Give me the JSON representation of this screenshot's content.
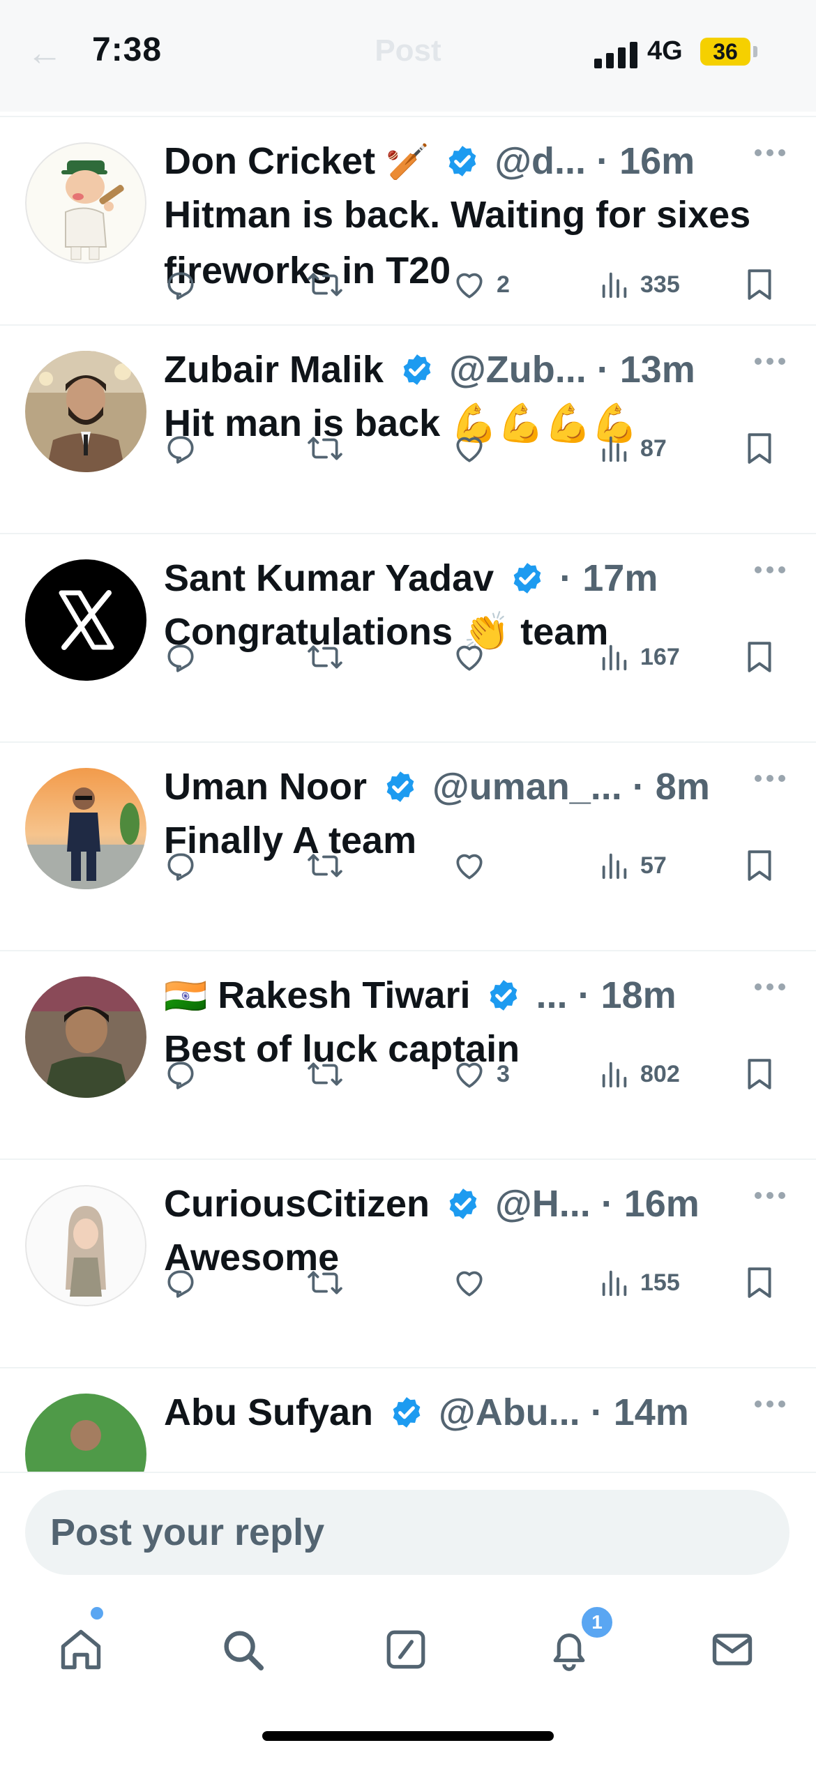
{
  "status_bar": {
    "time": "7:38",
    "network": "4G",
    "battery": "36"
  },
  "header": {
    "title": "Post"
  },
  "colors": {
    "accent": "#1d9bf0",
    "text": "#0f1419",
    "muted": "#536471",
    "battery": "#f5d000"
  },
  "tweets": [
    {
      "name": "Don Cricket",
      "name_emoji": "🏏",
      "handle": "@d...",
      "age": "16m",
      "text": "Hitman is back. Waiting for sixes fireworks in T20",
      "likes": "2",
      "views": "335",
      "avatar": "cartoon-cricketer"
    },
    {
      "name": "Zubair Malik",
      "handle": "@Zub...",
      "age": "13m",
      "text": "Hit man is back",
      "text_emoji": "💪💪💪💪",
      "likes": "",
      "views": "87",
      "avatar": "man-photo"
    },
    {
      "name": "Sant Kumar Yadav",
      "handle": "",
      "age": "17m",
      "text": "Congratulations",
      "text_emoji": "👏",
      "text_after": "team",
      "likes": "",
      "views": "167",
      "avatar": "x-logo"
    },
    {
      "name": "Uman Noor",
      "handle": "@uman_...",
      "age": "8m",
      "text": "Finally A team",
      "likes": "",
      "views": "57",
      "avatar": "man-sunset-photo"
    },
    {
      "name_prefix": "🇮🇳",
      "name": "Rakesh Tiwari",
      "handle": "...",
      "age": "18m",
      "text": "Best of luck captain",
      "likes": "3",
      "views": "802",
      "avatar": "man-photo-dark"
    },
    {
      "name": "CuriousCitizen",
      "handle": "@H...",
      "age": "16m",
      "text": "Awesome",
      "likes": "",
      "views": "155",
      "avatar": "memoji"
    },
    {
      "name": "Abu Sufyan",
      "handle": "@Abu...",
      "age": "14m",
      "text": "",
      "likes": "",
      "views": "",
      "avatar": "man-green-photo"
    }
  ],
  "reply_bar": {
    "placeholder": "Post your reply"
  },
  "tab_bar": {
    "items": [
      "home-icon",
      "search-icon",
      "compose-icon",
      "bell-icon",
      "mail-icon"
    ],
    "notification_count": "1"
  }
}
